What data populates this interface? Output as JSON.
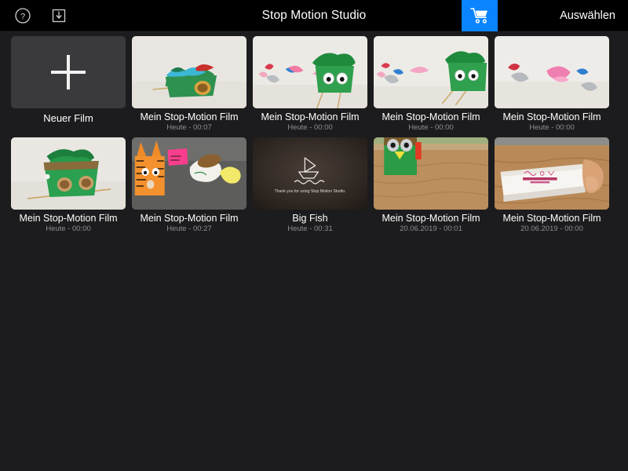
{
  "topbar": {
    "title": "Stop Motion Studio",
    "help_icon": "question-circle-icon",
    "import_icon": "import-download-icon",
    "cart_icon": "shopping-cart-icon",
    "cart_bg_color": "#0a84ff",
    "select_label": "Auswählen"
  },
  "grid": {
    "new_film": {
      "label": "Neuer Film",
      "icon": "plus-icon"
    },
    "items": [
      {
        "title": "Mein Stop-Motion Film",
        "meta": "Heute - 00:07",
        "scene": "green-boat-tissue"
      },
      {
        "title": "Mein Stop-Motion Film",
        "meta": "Heute - 00:00",
        "scene": "green-monster-googly"
      },
      {
        "title": "Mein Stop-Motion Film",
        "meta": "Heute - 00:00",
        "scene": "green-monster-right"
      },
      {
        "title": "Mein Stop-Motion Film",
        "meta": "Heute - 00:00",
        "scene": "crumpled-papers"
      },
      {
        "title": "Mein Stop-Motion Film",
        "meta": "Heute - 00:00",
        "scene": "green-cart-wheels"
      },
      {
        "title": "Mein Stop-Motion Film",
        "meta": "Heute - 00:27",
        "scene": "orange-tiger-desk"
      },
      {
        "title": "Big Fish",
        "meta": "Heute - 00:31",
        "scene": "endcard-boat",
        "endcard_text": "Thank you for using Stop Motion Studio."
      },
      {
        "title": "Mein Stop-Motion Film",
        "meta": "20.06.2019 - 00:01",
        "scene": "green-bird-wood"
      },
      {
        "title": "Mein Stop-Motion Film",
        "meta": "20.06.2019 - 00:00",
        "scene": "white-box-hand"
      }
    ]
  }
}
